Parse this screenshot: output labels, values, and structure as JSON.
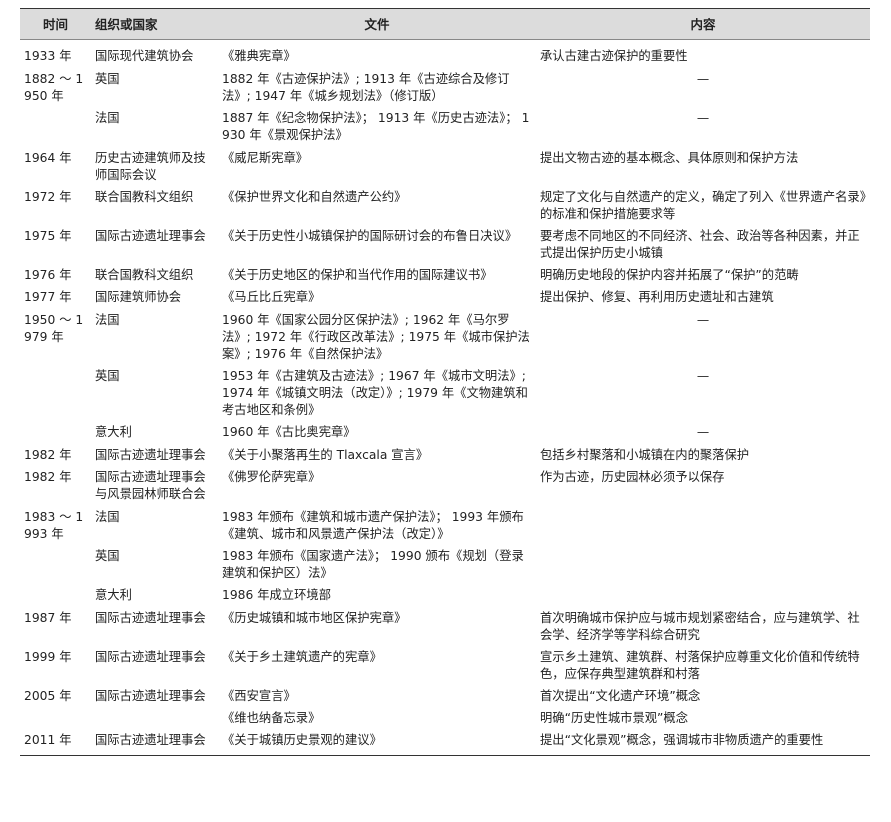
{
  "headers": {
    "time": "时间",
    "org": "组织或国家",
    "doc": "文件",
    "content": "内容"
  },
  "rows": [
    {
      "time": "1933 年",
      "org": "国际现代建筑协会",
      "doc": "《雅典宪章》",
      "content": "承认古建古迹保护的重要性"
    },
    {
      "time": "1882 ～ 1950 年",
      "org": "英国",
      "doc": "1882 年《古迹保护法》; 1913 年《古迹综合及修订法》; 1947 年《城乡规划法》（修订版）",
      "content": "—"
    },
    {
      "time": "",
      "org": "法国",
      "doc": "1887 年《纪念物保护法》； 1913 年《历史古迹法》； 1930 年《景观保护法》",
      "content": "—"
    },
    {
      "time": "1964 年",
      "org": "历史古迹建筑师及技师国际会议",
      "doc": "《威尼斯宪章》",
      "content": "提出文物古迹的基本概念、具体原则和保护方法"
    },
    {
      "time": "1972 年",
      "org": "联合国教科文组织",
      "doc": "《保护世界文化和自然遗产公约》",
      "content": "规定了文化与自然遗产的定义，确定了列入《世界遗产名录》的标准和保护措施要求等"
    },
    {
      "time": "1975 年",
      "org": "国际古迹遗址理事会",
      "doc": "《关于历史性小城镇保护的国际研讨会的布鲁日决议》",
      "content": "要考虑不同地区的不同经济、社会、政治等各种因素，并正式提出保护历史小城镇"
    },
    {
      "time": "1976 年",
      "org": "联合国教科文组织",
      "doc": "《关于历史地区的保护和当代作用的国际建议书》",
      "content": "明确历史地段的保护内容并拓展了“保护”的范畴"
    },
    {
      "time": "1977 年",
      "org": "国际建筑师协会",
      "doc": "《马丘比丘宪章》",
      "content": "提出保护、修复、再利用历史遗址和古建筑"
    },
    {
      "time": "1950 ～ 1979 年",
      "org": "法国",
      "doc": "1960 年《国家公园分区保护法》; 1962 年《马尔罗法》; 1972 年《行政区改革法》; 1975 年《城市保护法案》; 1976 年《自然保护法》",
      "content": "—"
    },
    {
      "time": "",
      "org": "英国",
      "doc": "1953 年《古建筑及古迹法》; 1967 年《城市文明法》; 1974 年《城镇文明法（改定）》; 1979 年《文物建筑和考古地区和条例》",
      "content": "—"
    },
    {
      "time": "",
      "org": "意大利",
      "doc": "1960 年《古比奥宪章》",
      "content": "—"
    },
    {
      "time": "1982 年",
      "org": "国际古迹遗址理事会",
      "doc": "《关于小聚落再生的 Tlaxcala 宣言》",
      "content": "包括乡村聚落和小城镇在内的聚落保护"
    },
    {
      "time": "1982 年",
      "org": "国际古迹遗址理事会与风景园林师联合会",
      "doc": "《佛罗伦萨宪章》",
      "content": "作为古迹，历史园林必须予以保存"
    },
    {
      "time": "1983 ～ 1993 年",
      "org": "法国",
      "doc": "1983 年颁布《建筑和城市遗产保护法》； 1993 年颁布《建筑、城市和风景遗产保护法（改定）》",
      "content": ""
    },
    {
      "time": "",
      "org": "英国",
      "doc": "1983 年颁布《国家遗产法》； 1990 颁布《规划（登录建筑和保护区）法》",
      "content": ""
    },
    {
      "time": "",
      "org": "意大利",
      "doc": "1986 年成立环境部",
      "content": ""
    },
    {
      "time": "1987 年",
      "org": "国际古迹遗址理事会",
      "doc": "《历史城镇和城市地区保护宪章》",
      "content": "首次明确城市保护应与城市规划紧密结合，应与建筑学、社会学、经济学等学科综合研究"
    },
    {
      "time": "1999 年",
      "org": "国际古迹遗址理事会",
      "doc": "《关于乡土建筑遗产的宪章》",
      "content": "宣示乡土建筑、建筑群、村落保护应尊重文化价值和传统特色，应保存典型建筑群和村落"
    },
    {
      "time": "2005 年",
      "org": "国际古迹遗址理事会",
      "doc": "《西安宣言》",
      "content": "首次提出“文化遗产环境”概念"
    },
    {
      "time": "",
      "org": "",
      "doc": "《维也纳备忘录》",
      "content": "明确“历史性城市景观”概念"
    },
    {
      "time": "2011 年",
      "org": "国际古迹遗址理事会",
      "doc": "《关于城镇历史景观的建议》",
      "content": "提出“文化景观”概念，强调城市非物质遗产的重要性"
    }
  ]
}
